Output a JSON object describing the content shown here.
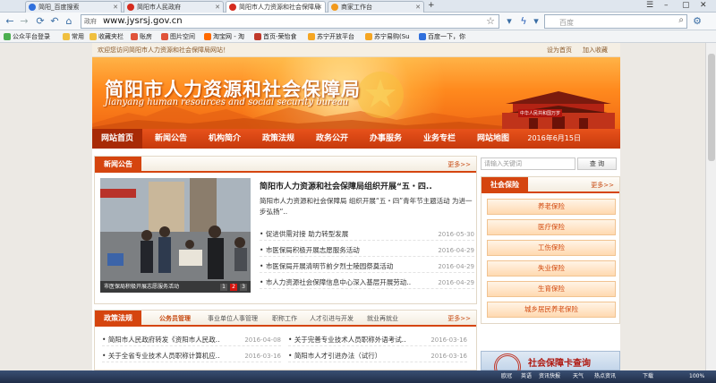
{
  "browser": {
    "tabs": [
      {
        "label": "简阳_百度搜索",
        "icon": "baidu-paw-icon"
      },
      {
        "label": "简阳市人民政府",
        "icon": "gov-emblem-icon"
      },
      {
        "label": "简阳市人力资源和社会保障局",
        "icon": "gov-emblem-icon"
      },
      {
        "label": "商家工作台",
        "icon": "shop-icon"
      }
    ],
    "new_tab": "+",
    "url_tag": "政府",
    "url": "www.jysrsj.gov.cn",
    "search_placeholder": "百度",
    "bookmarks": [
      "公众平台登录",
      "常用",
      "收藏夹栏",
      "账房",
      "图片空间",
      "淘宝网 - 淘",
      "首页-荣怡食",
      "苏宁开放平台",
      "苏宁易购(Su",
      "百度一下，你"
    ]
  },
  "site": {
    "welcome": "欢迎您访问简阳市人力资源和社会保障局网站！",
    "top_links": [
      "设为首页",
      "加入收藏"
    ],
    "title_cn": "简阳市人力资源和社会保障局",
    "title_en": "Jianyang human resources and social security bureau",
    "gate_label": "中华人民共和国万岁",
    "nav": [
      "网站首页",
      "新闻公告",
      "机构简介",
      "政策法规",
      "政务公开",
      "办事服务",
      "业务专栏",
      "网站地图"
    ],
    "date": "2016年6月15日"
  },
  "news": {
    "title": "新闻公告",
    "more": "更多>>",
    "photo_caption": "市医保局积极开展志愿服务活动",
    "pager": [
      "1",
      "2",
      "3"
    ],
    "headline": "简阳市人力资源和社会保障局组织开展“五・四..",
    "summary": "简阳市人力资源和社会保障局 组织开展“五・四”青年节主题活动 为进一步弘扬“..",
    "items": [
      {
        "title": "促进供需对接  助力转型发展",
        "date": "2016-05-30"
      },
      {
        "title": "市医保局积极开展志愿服务活动",
        "date": "2016-04-29"
      },
      {
        "title": "市医保局开展清明节前夕烈士陵园祭奠活动",
        "date": "2016-04-29"
      },
      {
        "title": "市人力资源社会保障信息中心深入基层开展劳动..",
        "date": "2016-04-29"
      }
    ]
  },
  "side": {
    "search_placeholder": "请输入关键词",
    "search_button": "查 询",
    "section_title": "社会保险",
    "more": "更多>>",
    "items": [
      "养老保险",
      "医疗保险",
      "工伤保险",
      "失业保险",
      "生育保险",
      "城乡居民养老保险"
    ],
    "card_text": "社会保障卡查询"
  },
  "policy": {
    "title": "政策法规",
    "more": "更多>>",
    "subtabs": [
      "公务员管理",
      "事业单位人事管理",
      "职称工作",
      "人才引进与开发",
      "就业再就业"
    ],
    "items": [
      {
        "title": "简阳市人民政府转发《资阳市人民政..",
        "date": "2016-04-08"
      },
      {
        "title": "关于完善专业技术人员职称外语考试..",
        "date": "2016-03-16"
      },
      {
        "title": "关于全省专业技术人员职称计算机应..",
        "date": "2016-03-16"
      },
      {
        "title": "简阳市人才引进办法（试行）",
        "date": "2016-03-16"
      }
    ]
  },
  "taskbar": {
    "items": [
      "欧冠",
      "英语",
      "资讯快报",
      "天气",
      "热点资讯",
      "下载",
      "100%"
    ]
  }
}
